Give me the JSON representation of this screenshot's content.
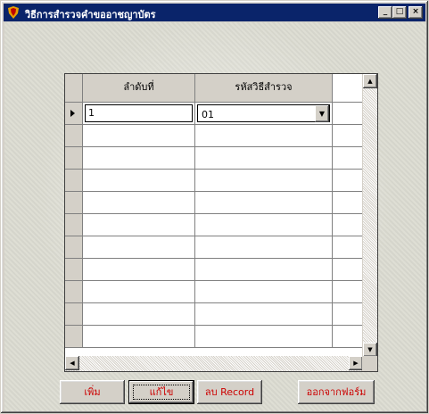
{
  "window": {
    "title": "วิธีการสำรวจคำขออาชญาบัตร",
    "min_label": "_",
    "max_label": "□",
    "close_label": "×"
  },
  "grid": {
    "columns": [
      "ลำดับที่",
      "รหัสวิธีสำรวจ"
    ],
    "rows": [
      {
        "order": "1",
        "code": "01"
      },
      {
        "order": "",
        "code": ""
      },
      {
        "order": "",
        "code": ""
      },
      {
        "order": "",
        "code": ""
      },
      {
        "order": "",
        "code": ""
      },
      {
        "order": "",
        "code": ""
      },
      {
        "order": "",
        "code": ""
      },
      {
        "order": "",
        "code": ""
      },
      {
        "order": "",
        "code": ""
      },
      {
        "order": "",
        "code": ""
      },
      {
        "order": "",
        "code": ""
      }
    ]
  },
  "buttons": {
    "add": "เพิ่ม",
    "edit": "แก้ไข",
    "delete": "ลบ Record",
    "exit": "ออกจากฟอร์ม"
  },
  "colors": {
    "titlebar": "#0a246a",
    "button_text": "#cc0000",
    "face": "#d4d0c8"
  }
}
